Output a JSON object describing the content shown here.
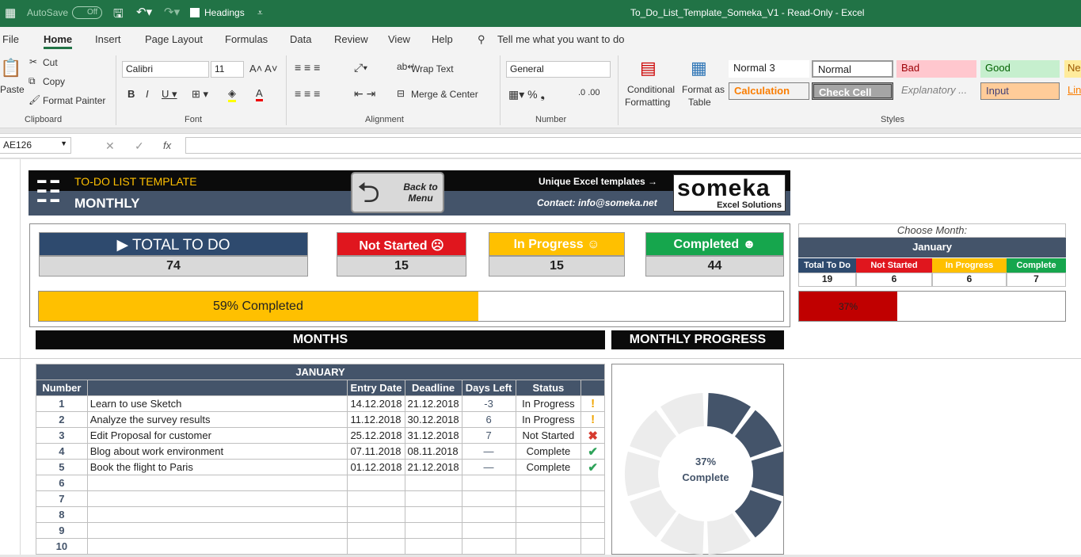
{
  "titlebar": {
    "autosave": "AutoSave",
    "autosave_state": "Off",
    "headings_label": "Headings",
    "doc_title": "To_Do_List_Template_Someka_V1  -  Read-Only  -  Excel"
  },
  "menu": {
    "file": "File",
    "home": "Home",
    "insert": "Insert",
    "page_layout": "Page Layout",
    "formulas": "Formulas",
    "data": "Data",
    "review": "Review",
    "view": "View",
    "help": "Help",
    "tell_me": "Tell me what you want to do"
  },
  "ribbon": {
    "paste": "Paste",
    "cut": "Cut",
    "copy": "Copy",
    "format_painter": "Format Painter",
    "clipboard": "Clipboard",
    "font_name": "Calibri",
    "font_size": "11",
    "font": "Font",
    "wrap_text": "Wrap Text",
    "merge_center": "Merge & Center",
    "alignment": "Alignment",
    "number_format": "General",
    "number": "Number",
    "conditional": "Conditional",
    "formatting": "Formatting",
    "format_as": "Format as",
    "table": "Table",
    "styles": "Styles",
    "style_normal3": "Normal 3",
    "style_normal": "Normal",
    "style_bad": "Bad",
    "style_good": "Good",
    "style_neutral": "Ne",
    "style_calculation": "Calculation",
    "style_check": "Check Cell",
    "style_explanatory": "Explanatory ...",
    "style_input": "Input",
    "style_linked": "Lin"
  },
  "formula_bar": {
    "name_box": "AE126",
    "fx": "fx",
    "value": ""
  },
  "dashboard": {
    "header_title": "TO-DO LIST TEMPLATE",
    "header_sub": "MONTHLY",
    "back_button": "Back to Menu",
    "unique": "Unique Excel templates →",
    "contact": "Contact: info@someka.net",
    "logo": "someka",
    "logo_sub": "Excel Solutions",
    "cards": {
      "total_label": "▶ TOTAL TO DO",
      "total": "74",
      "not_started_label": "Not Started",
      "not_started": "15",
      "in_progress_label": "In Progress",
      "in_progress": "15",
      "completed_label": "Completed",
      "completed": "44"
    },
    "progress_text": "59% Completed",
    "progress_fraction": 0.59,
    "choose_month": "Choose Month:",
    "month": "January",
    "mini_headers": [
      "Total To Do",
      "Not Started",
      "In Progress",
      "Complete"
    ],
    "mini_values": [
      "19",
      "6",
      "6",
      "7"
    ],
    "month_progress_text": "37%",
    "month_progress_fraction": 0.37,
    "months_title": "MONTHS",
    "monthly_progress_title": "MONTHLY PROGRESS",
    "donut_pct": "37%",
    "donut_label": "Complete",
    "donut_fraction": 0.37
  },
  "table": {
    "month_header": "JANUARY",
    "columns": [
      "Number",
      "",
      "Entry Date",
      "Deadline",
      "Days Left",
      "Status",
      ""
    ],
    "rows": [
      [
        "1",
        "Learn to use Sketch",
        "14.12.2018",
        "21.12.2018",
        "-3",
        "In Progress",
        "!"
      ],
      [
        "2",
        "Analyze the survey results",
        "11.12.2018",
        "30.12.2018",
        "6",
        "In Progress",
        "!"
      ],
      [
        "3",
        "Edit Proposal for customer",
        "25.12.2018",
        "31.12.2018",
        "7",
        "Not Started",
        "✖"
      ],
      [
        "4",
        "Blog about work environment",
        "07.11.2018",
        "08.11.2018",
        "—",
        "Complete",
        "✔"
      ],
      [
        "5",
        "Book the flight to Paris",
        "01.12.2018",
        "21.12.2018",
        "—",
        "Complete",
        "✔"
      ],
      [
        "6",
        "",
        "",
        "",
        "",
        "",
        ""
      ],
      [
        "7",
        "",
        "",
        "",
        "",
        "",
        ""
      ],
      [
        "8",
        "",
        "",
        "",
        "",
        "",
        ""
      ],
      [
        "9",
        "",
        "",
        "",
        "",
        "",
        ""
      ],
      [
        "10",
        "",
        "",
        "",
        "",
        "",
        ""
      ]
    ]
  },
  "colors": {
    "excel_green": "#217346",
    "navy": "#44546a",
    "red": "#e0161e",
    "yellow": "#ffc000",
    "green": "#16a64d"
  }
}
